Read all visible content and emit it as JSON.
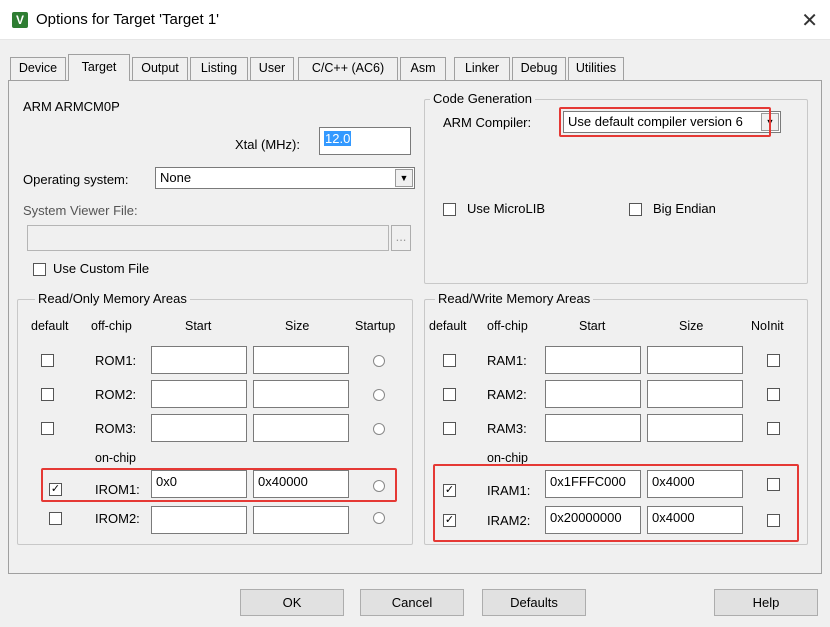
{
  "window": {
    "title": "Options for Target 'Target 1'",
    "app_icon_glyph": "V",
    "close_glyph": "✕"
  },
  "tabs": [
    {
      "label": "Device"
    },
    {
      "label": "Target",
      "active": true
    },
    {
      "label": "Output"
    },
    {
      "label": "Listing"
    },
    {
      "label": "User"
    },
    {
      "label": "C/C++ (AC6)"
    },
    {
      "label": "Asm"
    },
    {
      "label": "Linker"
    },
    {
      "label": "Debug"
    },
    {
      "label": "Utilities"
    }
  ],
  "target": {
    "device_name": "ARM ARMCM0P",
    "xtal_label": "Xtal (MHz):",
    "xtal_value": "12.0",
    "os_label": "Operating system:",
    "os_value": "None",
    "svf_label": "System Viewer File:",
    "svf_value": "",
    "browse_label": "...",
    "use_custom_file_label": "Use Custom File",
    "use_custom_file_checked": false
  },
  "code_generation": {
    "title": "Code Generation",
    "compiler_label": "ARM Compiler:",
    "compiler_value": "Use default compiler version 6",
    "use_microlib_label": "Use MicroLIB",
    "use_microlib_checked": false,
    "big_endian_label": "Big Endian",
    "big_endian_checked": false
  },
  "ro_memory": {
    "title": "Read/Only Memory Areas",
    "headers": {
      "default": "default",
      "offchip": "off-chip",
      "start": "Start",
      "size": "Size",
      "startup": "Startup"
    },
    "onchip_label": "on-chip",
    "rows": [
      {
        "name": "ROM1:",
        "default": false,
        "start": "",
        "size": "",
        "startup": false
      },
      {
        "name": "ROM2:",
        "default": false,
        "start": "",
        "size": "",
        "startup": false
      },
      {
        "name": "ROM3:",
        "default": false,
        "start": "",
        "size": "",
        "startup": false
      },
      {
        "name": "IROM1:",
        "default": true,
        "start": "0x0",
        "size": "0x40000",
        "startup": false
      },
      {
        "name": "IROM2:",
        "default": false,
        "start": "",
        "size": "",
        "startup": false
      }
    ]
  },
  "rw_memory": {
    "title": "Read/Write Memory Areas",
    "headers": {
      "default": "default",
      "offchip": "off-chip",
      "start": "Start",
      "size": "Size",
      "noinit": "NoInit"
    },
    "onchip_label": "on-chip",
    "rows": [
      {
        "name": "RAM1:",
        "default": false,
        "start": "",
        "size": "",
        "noinit": false
      },
      {
        "name": "RAM2:",
        "default": false,
        "start": "",
        "size": "",
        "noinit": false
      },
      {
        "name": "RAM3:",
        "default": false,
        "start": "",
        "size": "",
        "noinit": false
      },
      {
        "name": "IRAM1:",
        "default": true,
        "start": "0x1FFFC000",
        "size": "0x4000",
        "noinit": false
      },
      {
        "name": "IRAM2:",
        "default": true,
        "start": "0x20000000",
        "size": "0x4000",
        "noinit": false
      }
    ]
  },
  "buttons": {
    "ok": "OK",
    "cancel": "Cancel",
    "defaults": "Defaults",
    "help": "Help"
  },
  "colors": {
    "highlight": "#e53935",
    "selection": "#3399ff"
  }
}
